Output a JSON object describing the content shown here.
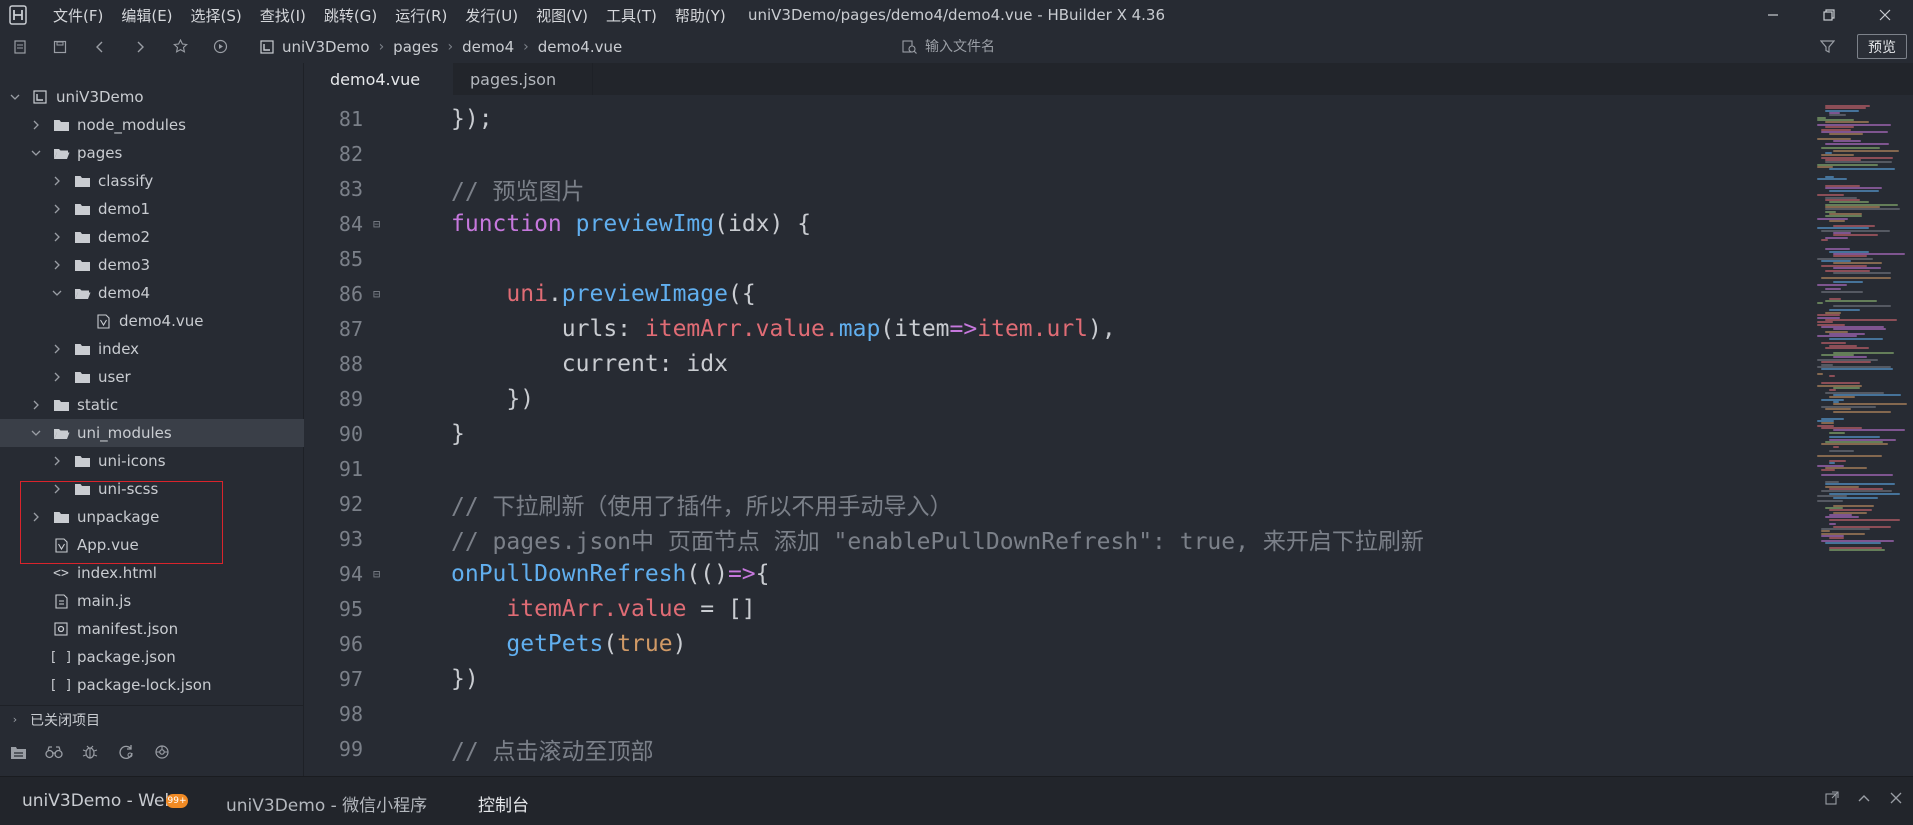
{
  "app": {
    "window_title": "uniV3Demo/pages/demo4/demo4.vue - HBuilder X 4.36",
    "menu": [
      "文件(F)",
      "编辑(E)",
      "选择(S)",
      "查找(I)",
      "跳转(G)",
      "运行(R)",
      "发行(U)",
      "视图(V)",
      "工具(T)",
      "帮助(Y)"
    ]
  },
  "toolbar": {
    "breadcrumb": [
      "uniV3Demo",
      "pages",
      "demo4",
      "demo4.vue"
    ],
    "search_placeholder": "输入文件名",
    "preview_label": "预览"
  },
  "sidebar": {
    "tree": [
      {
        "label": "uniV3Demo",
        "type": "project",
        "expanded": true
      },
      {
        "label": "node_modules",
        "type": "folder",
        "expanded": false
      },
      {
        "label": "pages",
        "type": "folder",
        "expanded": true
      },
      {
        "label": "classify",
        "type": "folder",
        "expanded": false
      },
      {
        "label": "demo1",
        "type": "folder",
        "expanded": false
      },
      {
        "label": "demo2",
        "type": "folder",
        "expanded": false
      },
      {
        "label": "demo3",
        "type": "folder",
        "expanded": false
      },
      {
        "label": "demo4",
        "type": "folder",
        "expanded": true
      },
      {
        "label": "demo4.vue",
        "type": "vue-file"
      },
      {
        "label": "index",
        "type": "folder",
        "expanded": false
      },
      {
        "label": "user",
        "type": "folder",
        "expanded": false
      },
      {
        "label": "static",
        "type": "folder",
        "expanded": false
      },
      {
        "label": "uni_modules",
        "type": "folder",
        "expanded": true,
        "selected": true
      },
      {
        "label": "uni-icons",
        "type": "folder",
        "expanded": false
      },
      {
        "label": "uni-scss",
        "type": "folder",
        "expanded": false
      },
      {
        "label": "unpackage",
        "type": "folder",
        "expanded": false
      },
      {
        "label": "App.vue",
        "type": "vue-file"
      },
      {
        "label": "index.html",
        "type": "html-file"
      },
      {
        "label": "main.js",
        "type": "js-file"
      },
      {
        "label": "manifest.json",
        "type": "settings-file"
      },
      {
        "label": "package.json",
        "type": "json-file"
      },
      {
        "label": "package-lock.json",
        "type": "json-file"
      }
    ],
    "closed_projects_label": "已关闭项目"
  },
  "editor": {
    "tabs": [
      {
        "label": "demo4.vue",
        "active": true
      },
      {
        "label": "pages.json",
        "active": false
      }
    ],
    "lines": [
      {
        "num": "81",
        "fold": false
      },
      {
        "num": "82",
        "fold": false
      },
      {
        "num": "83",
        "fold": false
      },
      {
        "num": "84",
        "fold": true
      },
      {
        "num": "85",
        "fold": false
      },
      {
        "num": "86",
        "fold": true
      },
      {
        "num": "87",
        "fold": false
      },
      {
        "num": "88",
        "fold": false
      },
      {
        "num": "89",
        "fold": false
      },
      {
        "num": "90",
        "fold": false
      },
      {
        "num": "91",
        "fold": false
      },
      {
        "num": "92",
        "fold": false
      },
      {
        "num": "93",
        "fold": false
      },
      {
        "num": "94",
        "fold": true
      },
      {
        "num": "95",
        "fold": false
      },
      {
        "num": "96",
        "fold": false
      },
      {
        "num": "97",
        "fold": false
      },
      {
        "num": "98",
        "fold": false
      },
      {
        "num": "99",
        "fold": false
      }
    ],
    "code": {
      "l81": "});",
      "l83": "// 预览图片",
      "l84_kw": "function",
      "l84_fn": "previewImg",
      "l84_rest": "(idx) {",
      "l86_obj": "uni",
      "l86_dot": ".",
      "l86_fn": "previewImage",
      "l86_rest": "({",
      "l87_key": "urls: ",
      "l87_obj": "itemArr",
      "l87_prop": ".value.",
      "l87_fn": "map",
      "l87_p1": "(item",
      "l87_arrow": "=>",
      "l87_item": "item",
      "l87_url": ".url",
      "l87_end": "),",
      "l88": "current: idx",
      "l89": "})",
      "l90": "}",
      "l92": "// 下拉刷新（使用了插件，所以不用手动导入）",
      "l93": "// pages.json中 页面节点 添加 \"enablePullDownRefresh\": true, 来开启下拉刷新",
      "l94_fn": "onPullDownRefresh",
      "l94_p": "(()",
      "l94_arrow": "=>",
      "l94_end": "{",
      "l95_obj": "itemArr",
      "l95_rest": ".value",
      "l95_eq": " = []",
      "l96_fn": "getPets",
      "l96_p1": "(",
      "l96_bool": "true",
      "l96_p2": ")",
      "l97": "})",
      "l99": "// 点击滚动至顶部"
    }
  },
  "bottom_panel": {
    "tabs": [
      "uniV3Demo - Web",
      "uniV3Demo - 微信小程序",
      "控制台"
    ],
    "badge": "99+"
  },
  "colors": {
    "background": "#272b33",
    "keyword": "#c678dd",
    "function": "#61afef",
    "variable": "#e06c75",
    "comment": "#7b8089",
    "boolean": "#d19a66",
    "highlight_box": "#d9242c",
    "badge": "#f08a24"
  }
}
